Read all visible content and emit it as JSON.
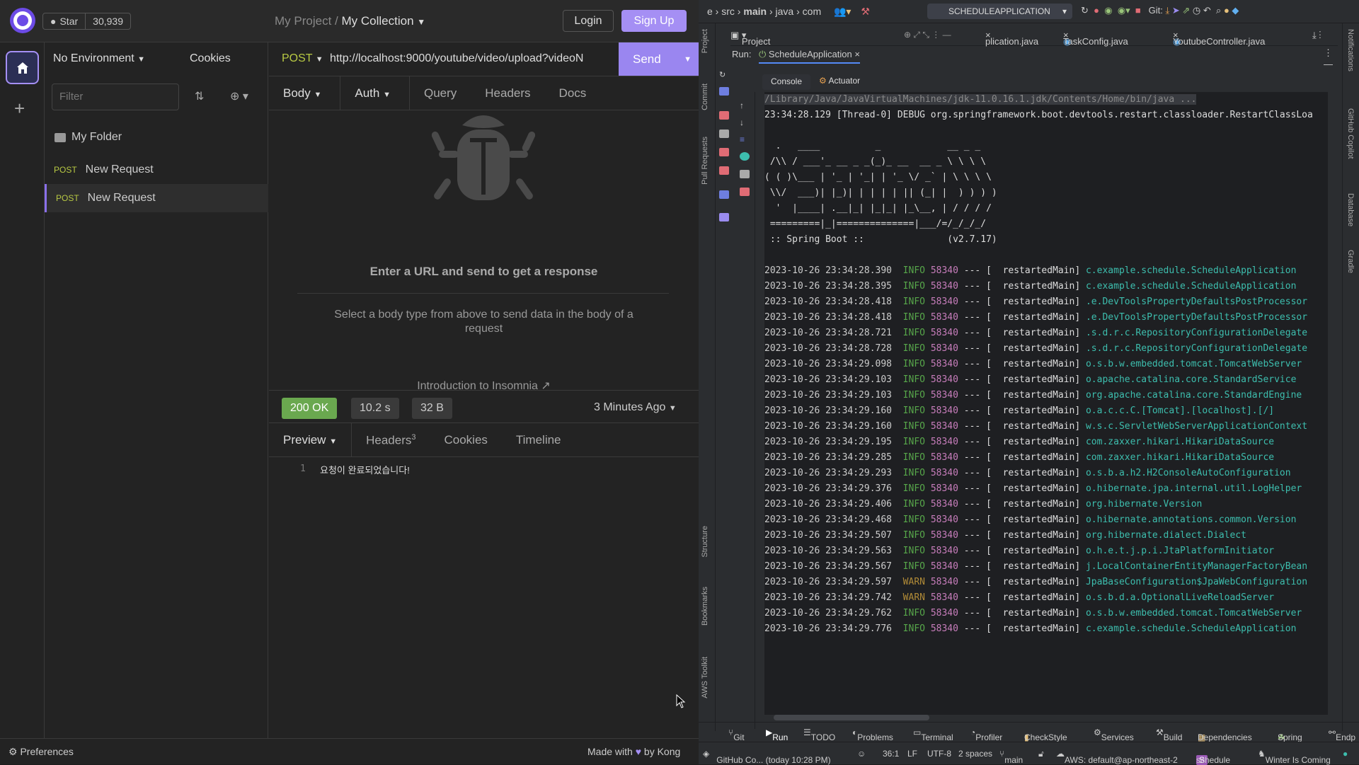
{
  "insomnia": {
    "github": {
      "star_label": "Star",
      "star_count": "30,939"
    },
    "breadcrumb": {
      "project": "My Project",
      "separator": "/",
      "collection": "My Collection"
    },
    "login_label": "Login",
    "signup_label": "Sign Up",
    "environment": "No Environment",
    "cookies_label": "Cookies",
    "filter_placeholder": "Filter",
    "folder_name": "My Folder",
    "requests": [
      {
        "method": "POST",
        "name": "New Request"
      },
      {
        "method": "POST",
        "name": "New Request"
      }
    ],
    "request": {
      "method": "POST",
      "url": "http://localhost:9000/youtube/video/upload?videoN",
      "send_label": "Send"
    },
    "request_tabs": [
      "Body",
      "Auth",
      "Query",
      "Headers",
      "Docs"
    ],
    "empty_title": "Enter a URL and send to get a response",
    "empty_body": "Select a body type from above to send data in the body of a request",
    "intro_link": "Introduction to Insomnia",
    "response": {
      "status": "200 OK",
      "time": "10.2 s",
      "size": "32 B",
      "age": "3 Minutes Ago",
      "tabs": [
        "Preview",
        "Headers",
        "Cookies",
        "Timeline"
      ],
      "headers_count": "3",
      "line_number": "1",
      "body": "요청이 완료되었습니다!"
    },
    "footer": {
      "preferences": "Preferences",
      "made_with": "Made with",
      "by": "by Kong"
    },
    "colors": {
      "accent": "#a58ff4",
      "post": "#b8c943",
      "ok": "#6aa84f"
    }
  },
  "ide": {
    "nav": {
      "e": "e",
      "src": "src",
      "main": "main",
      "java": "java",
      "com": "com"
    },
    "run_config": "SCHEDULEAPPLICATION",
    "git_label": "Git:",
    "project_label": "Project",
    "file_tabs": [
      "plication.java",
      "TaskConfig.java",
      "YoutubeController.java"
    ],
    "run_label": "Run:",
    "run_tab": "ScheduleApplication",
    "console_tabs": [
      "Console",
      "Actuator"
    ],
    "left_strip": [
      "Project",
      "Commit",
      "Pull Requests",
      "Structure",
      "Bookmarks",
      "AWS Toolkit"
    ],
    "right_strip": [
      "Notifications",
      "GitHub Copilot",
      "Database",
      "Gradle"
    ],
    "java_path": "/Library/Java/JavaVirtualMachines/jdk-11.0.16.1.jdk/Contents/Home/bin/java ...",
    "debug_line": "23:34:28.129 [Thread-0] DEBUG org.springframework.boot.devtools.restart.classloader.RestartClassLoa",
    "banner": [
      "  .   ____          _            __ _ _",
      " /\\\\ / ___'_ __ _ _(_)_ __  __ _ \\ \\ \\ \\",
      "( ( )\\___ | '_ | '_| | '_ \\/ _` | \\ \\ \\ \\",
      " \\\\/  ___)| |_)| | | | | || (_| |  ) ) ) )",
      "  '  |____| .__|_| |_|_| |_\\__, | / / / /",
      " =========|_|==============|___/=/_/_/_/",
      " :: Spring Boot ::               (v2.7.17)"
    ],
    "log_lines": [
      {
        "ts": "2023-10-26 23:34:28.390",
        "level": "INFO",
        "pid": "58340",
        "thread": "restartedMain",
        "logger": "c.example.schedule.ScheduleApplication"
      },
      {
        "ts": "2023-10-26 23:34:28.395",
        "level": "INFO",
        "pid": "58340",
        "thread": "restartedMain",
        "logger": "c.example.schedule.ScheduleApplication"
      },
      {
        "ts": "2023-10-26 23:34:28.418",
        "level": "INFO",
        "pid": "58340",
        "thread": "restartedMain",
        "logger": ".e.DevToolsPropertyDefaultsPostProcessor"
      },
      {
        "ts": "2023-10-26 23:34:28.418",
        "level": "INFO",
        "pid": "58340",
        "thread": "restartedMain",
        "logger": ".e.DevToolsPropertyDefaultsPostProcessor"
      },
      {
        "ts": "2023-10-26 23:34:28.721",
        "level": "INFO",
        "pid": "58340",
        "thread": "restartedMain",
        "logger": ".s.d.r.c.RepositoryConfigurationDelegate"
      },
      {
        "ts": "2023-10-26 23:34:28.728",
        "level": "INFO",
        "pid": "58340",
        "thread": "restartedMain",
        "logger": ".s.d.r.c.RepositoryConfigurationDelegate"
      },
      {
        "ts": "2023-10-26 23:34:29.098",
        "level": "INFO",
        "pid": "58340",
        "thread": "restartedMain",
        "logger": "o.s.b.w.embedded.tomcat.TomcatWebServer"
      },
      {
        "ts": "2023-10-26 23:34:29.103",
        "level": "INFO",
        "pid": "58340",
        "thread": "restartedMain",
        "logger": "o.apache.catalina.core.StandardService"
      },
      {
        "ts": "2023-10-26 23:34:29.103",
        "level": "INFO",
        "pid": "58340",
        "thread": "restartedMain",
        "logger": "org.apache.catalina.core.StandardEngine"
      },
      {
        "ts": "2023-10-26 23:34:29.160",
        "level": "INFO",
        "pid": "58340",
        "thread": "restartedMain",
        "logger": "o.a.c.c.C.[Tomcat].[localhost].[/]"
      },
      {
        "ts": "2023-10-26 23:34:29.160",
        "level": "INFO",
        "pid": "58340",
        "thread": "restartedMain",
        "logger": "w.s.c.ServletWebServerApplicationContext"
      },
      {
        "ts": "2023-10-26 23:34:29.195",
        "level": "INFO",
        "pid": "58340",
        "thread": "restartedMain",
        "logger": "com.zaxxer.hikari.HikariDataSource"
      },
      {
        "ts": "2023-10-26 23:34:29.285",
        "level": "INFO",
        "pid": "58340",
        "thread": "restartedMain",
        "logger": "com.zaxxer.hikari.HikariDataSource"
      },
      {
        "ts": "2023-10-26 23:34:29.293",
        "level": "INFO",
        "pid": "58340",
        "thread": "restartedMain",
        "logger": "o.s.b.a.h2.H2ConsoleAutoConfiguration"
      },
      {
        "ts": "2023-10-26 23:34:29.376",
        "level": "INFO",
        "pid": "58340",
        "thread": "restartedMain",
        "logger": "o.hibernate.jpa.internal.util.LogHelper"
      },
      {
        "ts": "2023-10-26 23:34:29.406",
        "level": "INFO",
        "pid": "58340",
        "thread": "restartedMain",
        "logger": "org.hibernate.Version"
      },
      {
        "ts": "2023-10-26 23:34:29.468",
        "level": "INFO",
        "pid": "58340",
        "thread": "restartedMain",
        "logger": "o.hibernate.annotations.common.Version"
      },
      {
        "ts": "2023-10-26 23:34:29.507",
        "level": "INFO",
        "pid": "58340",
        "thread": "restartedMain",
        "logger": "org.hibernate.dialect.Dialect"
      },
      {
        "ts": "2023-10-26 23:34:29.563",
        "level": "INFO",
        "pid": "58340",
        "thread": "restartedMain",
        "logger": "o.h.e.t.j.p.i.JtaPlatformInitiator"
      },
      {
        "ts": "2023-10-26 23:34:29.567",
        "level": "INFO",
        "pid": "58340",
        "thread": "restartedMain",
        "logger": "j.LocalContainerEntityManagerFactoryBean"
      },
      {
        "ts": "2023-10-26 23:34:29.597",
        "level": "WARN",
        "pid": "58340",
        "thread": "restartedMain",
        "logger": "JpaBaseConfiguration$JpaWebConfiguration"
      },
      {
        "ts": "2023-10-26 23:34:29.742",
        "level": "WARN",
        "pid": "58340",
        "thread": "restartedMain",
        "logger": "o.s.b.d.a.OptionalLiveReloadServer"
      },
      {
        "ts": "2023-10-26 23:34:29.762",
        "level": "INFO",
        "pid": "58340",
        "thread": "restartedMain",
        "logger": "o.s.b.w.embedded.tomcat.TomcatWebServer"
      },
      {
        "ts": "2023-10-26 23:34:29.776",
        "level": "INFO",
        "pid": "58340",
        "thread": "restartedMain",
        "logger": "c.example.schedule.ScheduleApplication"
      }
    ],
    "bottom_tools": [
      "Git",
      "Run",
      "TODO",
      "Problems",
      "Terminal",
      "Profiler",
      "CheckStyle",
      "Services",
      "Build",
      "Dependencies",
      "Spring",
      "Endp"
    ],
    "status": {
      "copilot": "GitHub Co... (today 10:28 PM)",
      "position": "36:1",
      "line_sep": "LF",
      "encoding": "UTF-8",
      "indent": "2 spaces",
      "branch": "main",
      "aws": "AWS: default@ap-northeast-2",
      "project": "schedule",
      "theme": "Winter Is Coming"
    }
  }
}
